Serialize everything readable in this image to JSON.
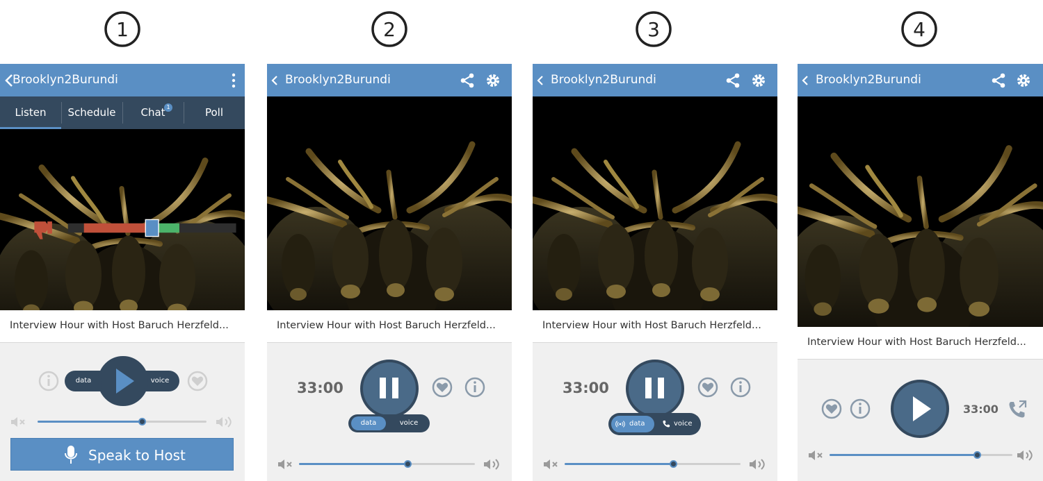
{
  "steps": [
    "1",
    "2",
    "3",
    "4"
  ],
  "app": {
    "title": "Brooklyn2Burundi"
  },
  "tabs": [
    {
      "label": "Listen",
      "active": true
    },
    {
      "label": "Schedule",
      "active": false
    },
    {
      "label": "Chat",
      "active": false,
      "badge": "1"
    },
    {
      "label": "Poll",
      "active": false
    }
  ],
  "rating_meter": {
    "negative_fraction": 0.45,
    "positive_fraction": 0.25,
    "marker_fraction": 0.5
  },
  "show_title": "Interview Hour with Host Baruch Herzfeld...",
  "player": {
    "time": "33:00",
    "toggle": {
      "data_label": "data",
      "voice_label": "voice"
    },
    "volume_fraction_1": 0.62,
    "volume_fraction_2": 0.62,
    "volume_fraction_3": 0.62,
    "volume_fraction_4": 0.81
  },
  "speak_button": {
    "label": "Speak to Host"
  },
  "icons": {
    "back": "chevron-left-icon",
    "more": "kebab-menu-icon",
    "share": "share-icon",
    "settings": "gear-icon",
    "info": "info-icon",
    "favorite": "heart-icon",
    "play": "play-icon",
    "pause": "pause-icon",
    "mute": "volume-mute-icon",
    "volume": "volume-up-icon",
    "mic": "microphone-icon",
    "phone": "phone-icon",
    "data_signal": "signal-icon",
    "thumbs_down": "thumbs-down-icon",
    "thumbs_up": "thumbs-up-icon"
  },
  "colors": {
    "appbar": "#5a8fc4",
    "tabbar": "#34495e",
    "accent": "#5a8fc4",
    "dark": "#34495e",
    "negative": "#c0503a",
    "positive": "#4cb36a"
  }
}
